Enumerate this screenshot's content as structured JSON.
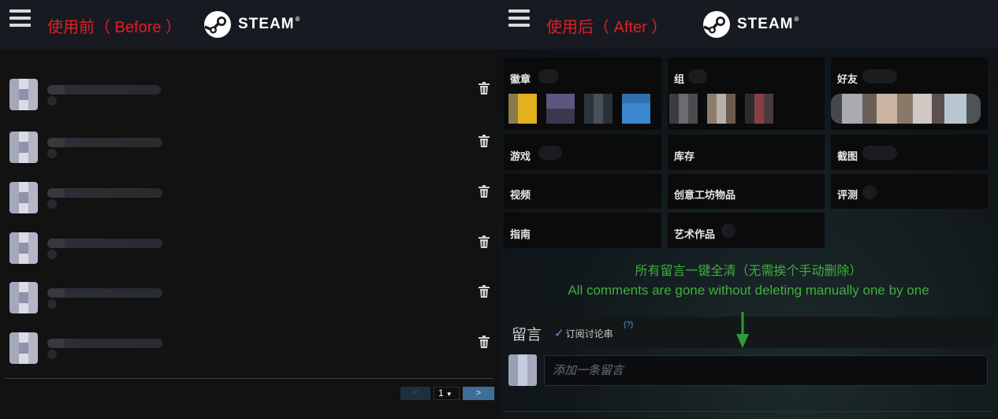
{
  "before": {
    "caption": "使用前（ Before ）",
    "pagination": {
      "prev": "<",
      "page": "1",
      "next": ">"
    }
  },
  "after": {
    "caption": "使用后（ After ）",
    "tiles": {
      "badges": "徽章",
      "groups": "组",
      "friends": "好友",
      "games": "游戏",
      "inventory": "库存",
      "screenshots": "截图",
      "videos": "视频",
      "workshop": "创意工坊物品",
      "reviews": "评测",
      "guides": "指南",
      "artwork": "艺术作品"
    },
    "note_cn": "所有留言一键全清（无需挨个手动删除）",
    "note_en": "All comments are gone without deleting manually one by one",
    "comments": {
      "title": "留言",
      "subscribe_label": "订阅讨论串",
      "help": "(?)",
      "placeholder": "添加一条留言"
    }
  },
  "brand": {
    "name": "STEAM",
    "reg": "®"
  },
  "colors": {
    "caption_red": "#e31e24",
    "note_green": "#3fae3f",
    "topbar": "#171a21",
    "steam_blue_button": "#3e6e95"
  }
}
